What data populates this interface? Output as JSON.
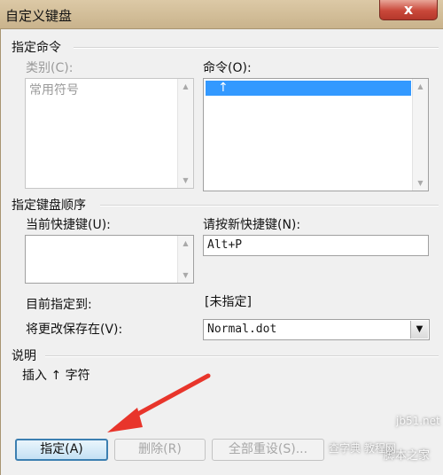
{
  "window": {
    "title": "自定义键盘",
    "close_glyph": "x"
  },
  "specify_command": {
    "heading": "指定命令",
    "categories_label": "类别(C):",
    "categories_items": [
      "常用符号"
    ],
    "commands_label": "命令(O):",
    "commands_selected": "↑"
  },
  "key_sequence": {
    "heading": "指定键盘顺序",
    "current_keys_label": "当前快捷键(U):",
    "current_keys_value": "",
    "new_key_label": "请按新快捷键(N):",
    "new_key_value": "Alt+P"
  },
  "assignment": {
    "currently_assigned_label": "目前指定到:",
    "currently_assigned_value": "[未指定]",
    "save_in_label": "将更改保存在(V):",
    "save_in_value": "Normal.dot"
  },
  "description": {
    "heading": "说明",
    "text": "插入 ↑ 字符"
  },
  "buttons": {
    "assign": "指定(A)",
    "remove": "删除(R)",
    "reset_all": "全部重设(S)..."
  },
  "icons": {
    "scroll_up": "scroll-up-arrow-icon",
    "scroll_down": "scroll-down-arrow-icon",
    "dropdown": "chevron-down-icon",
    "annotation_arrow": "red-arrow-icon"
  },
  "colors": {
    "selection": "#3399ff",
    "annotation_arrow": "#e8352b"
  },
  "watermark": {
    "site": "jb51.net",
    "brand": "脚本之家",
    "tutorial": "查字典 教程网"
  }
}
